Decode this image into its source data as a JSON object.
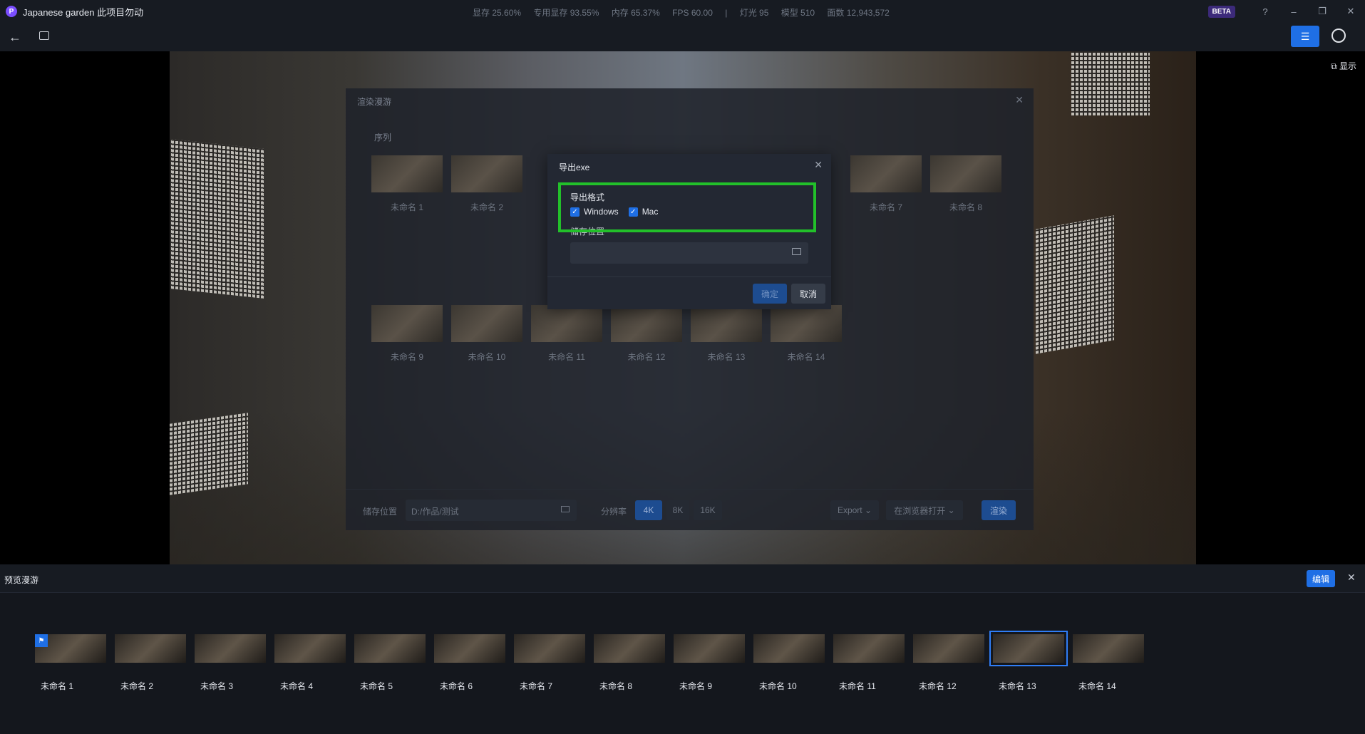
{
  "app": {
    "logo_letter": "P",
    "title": "Japanese garden 此项目勿动"
  },
  "stats": [
    "显存 25.60%",
    "专用显存 93.55%",
    "内存 65.37%",
    "FPS 60.00",
    "|",
    "灯光 95",
    "模型 510",
    "面数 12,943,572"
  ],
  "window": {
    "beta": "BETA"
  },
  "viewport": {
    "display_toggle": "显示"
  },
  "render_dialog": {
    "title": "渲染漫游",
    "sequence_label": "序列",
    "thumbs": [
      "未命名 1",
      "未命名 2",
      "未命名 7",
      "未命名 8",
      "未命名 9",
      "未命名 10",
      "未命名 11",
      "未命名 12",
      "未命名 13",
      "未命名 14"
    ],
    "footer": {
      "storage_label": "储存位置",
      "storage_value": "D:/作品/测试",
      "resolution_label": "分辨率",
      "res_4k": "4K",
      "res_8k": "8K",
      "res_16k": "16K",
      "export": "Export",
      "open_browser": "在浏览器打开",
      "render": "渲染"
    }
  },
  "export_modal": {
    "title": "导出exe",
    "format_label": "导出格式",
    "windows": "Windows",
    "mac": "Mac",
    "storage_label": "储存位置",
    "confirm": "确定",
    "cancel": "取消"
  },
  "preview": {
    "title": "预览漫游",
    "edit": "编辑",
    "items": [
      "未命名 1",
      "未命名 2",
      "未命名 3",
      "未命名 4",
      "未命名 5",
      "未命名 6",
      "未命名 7",
      "未命名 8",
      "未命名 9",
      "未命名 10",
      "未命名 11",
      "未命名 12",
      "未命名 13",
      "未命名 14"
    ]
  }
}
